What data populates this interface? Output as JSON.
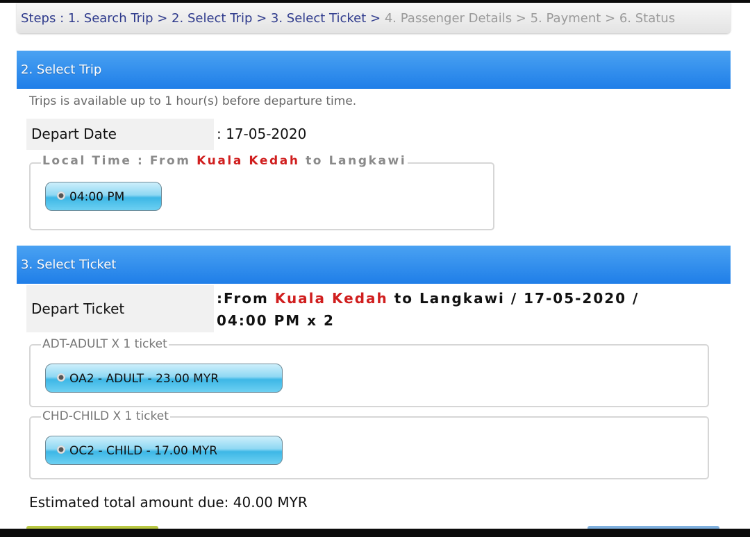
{
  "steps": {
    "prefix": "Steps : ",
    "items": [
      {
        "label": "1. Search Trip",
        "sep": " > "
      },
      {
        "label": "2. Select Trip",
        "sep": " > "
      },
      {
        "label": "3. Select Ticket",
        "sep": " > "
      },
      {
        "label": "4. Passenger Details",
        "sep": " > "
      },
      {
        "label": "5. Payment",
        "sep": " > "
      },
      {
        "label": "6. Status",
        "sep": ""
      }
    ]
  },
  "select_trip": {
    "header": "2. Select Trip",
    "note": "Trips is available up to 1 hour(s) before departure time.",
    "depart_date_label": "Depart Date",
    "depart_date_value": ": 17-05-2020",
    "legend": {
      "prefix": "Local Time : From ",
      "origin": "Kuala Kedah",
      "middle": " to ",
      "destination": "Langkawi"
    },
    "time_option": "04:00 PM"
  },
  "select_ticket": {
    "header": "3. Select Ticket",
    "depart_ticket_label": "Depart Ticket",
    "ticket": {
      "line1_prefix": ":From ",
      "origin": "Kuala Kedah",
      "line1_suffix": " to Langkawi / 17-05-2020 /",
      "line2": "04:00 PM x 2"
    },
    "adult_legend": "ADT-ADULT X 1 ticket",
    "adult_option": "OA2 - ADULT - 23.00 MYR",
    "child_legend": "CHD-CHILD X 1 ticket",
    "child_option": "OC2 - CHILD - 17.00 MYR"
  },
  "total": "Estimated total amount due: 40.00 MYR",
  "colors": {
    "header_blue": "#2580ea",
    "accent_red": "#d01e1e",
    "step_done": "#2e3a8c",
    "step_todo": "#9a9a9a"
  }
}
